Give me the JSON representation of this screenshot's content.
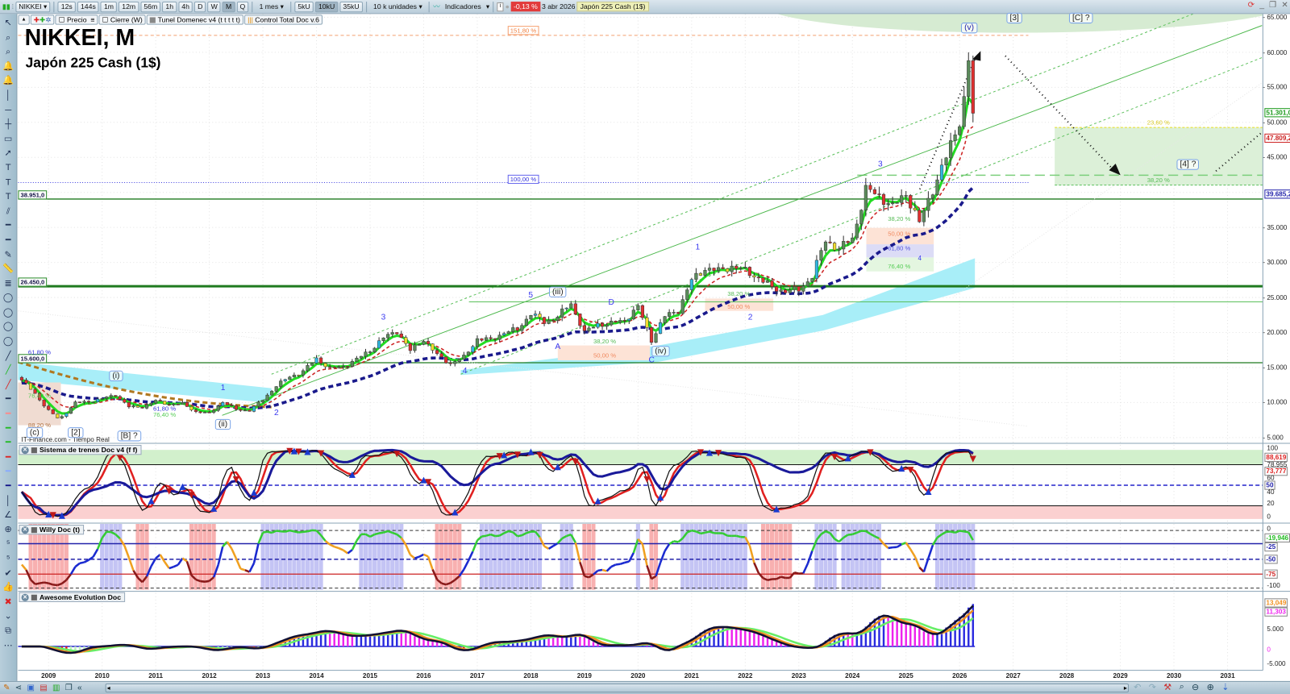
{
  "toolbar": {
    "symbol": "NIKKEI",
    "timeframes": [
      "12s",
      "144s",
      "1m",
      "12m",
      "56m",
      "1h",
      "4h",
      "D",
      "W",
      "M",
      "Q"
    ],
    "active_timeframe": "M",
    "period": "1 mes",
    "units": [
      "5kU",
      "10kU",
      "35kU"
    ],
    "active_unit": "10kU",
    "unit_select": "10 k unidades",
    "indicators": "Indicadores",
    "change": "-0,13 %",
    "date": "3 abr 2026",
    "instrument": "Japón 225 Cash (1$)"
  },
  "legend_row": [
    "Precio",
    "Cierre (W)",
    "Tunel Domenec v4 (t t t t t)",
    "Control Total Doc v.6"
  ],
  "chart": {
    "title": "NIKKEI, M",
    "subtitle": "Japón 225 Cash (1$)",
    "watermark": "IT-Finance.com - Tiempo Real"
  },
  "left_tools": [
    "cursor-icon",
    "zoom-icon",
    "zoom-area-icon",
    "alert-edit-icon",
    "alert-icon",
    "vertical-line-icon",
    "horizontal-line-icon",
    "cross-line-icon",
    "rectangle-icon",
    "arrow-icon",
    "text-icon",
    "text-box-icon",
    "text-marker-icon",
    "channel-icon",
    "line-tool-icon",
    "line-tool-icon-2",
    "pen-icon",
    "ruler-icon",
    "fibonacci-icon",
    "ellipse-icon",
    "ellipse-icon-2",
    "ellipse-icon-3",
    "ellipse-icon-4",
    "trendline-black-icon",
    "trendline-green-icon",
    "trendline-red-icon",
    "line-gray-icon",
    "line-salmon-icon",
    "line-green-icon",
    "line-darkgreen-icon",
    "line-red-icon",
    "line-lightblue-icon",
    "line-navy-icon",
    "vertical-bar-icon",
    "angle-icon",
    "target-icon",
    "elliott-icon",
    "elliott-abc-icon",
    "checkmark-icon",
    "thumbs-up-icon",
    "delete-icon",
    "collapse-icon",
    "layers-icon",
    "more-icon"
  ],
  "price_levels": [
    "38.951,0",
    "26.450,0",
    "15.600,0"
  ],
  "wave_labels": [
    "1",
    "2",
    "3",
    "4",
    "5",
    "1",
    "2",
    "3",
    "4",
    "A",
    "D",
    "C"
  ],
  "boxed_labels": [
    "(i)",
    "(ii)",
    "(iii)",
    "(iv)",
    "(v)",
    "[3]",
    "[C] ?",
    "[4] ?",
    "(c)",
    "[2]",
    "[B] ?"
  ],
  "fib_labels": [
    "151,80 %",
    "100,00 %",
    "61,80 %",
    "76,40 %",
    "88,20 %",
    "61,80 %",
    "76,40 %",
    "38,20 %",
    "50,00 %",
    "38,20 %",
    "50,00 %",
    "38,20 %",
    "50,00 %",
    "61,80 %",
    "76,40 %",
    "23,60 %",
    "38,20 %"
  ],
  "panels": {
    "trenes": "Sistema de trenes Doc v4 (f f)",
    "willy": "Willy Doc (t)",
    "awesome": "Awesome Evolution Doc"
  },
  "axis": {
    "price_ticks": [
      "65.000",
      "60.000",
      "55.000",
      "50.000",
      "45.000",
      "35.000",
      "30.000",
      "25.000",
      "20.000",
      "15.000",
      "10.000",
      "5.000"
    ],
    "price_badges": {
      "close": "51.301,0",
      "ema": "47.809,2",
      "trend": "39.685,2"
    },
    "trenes_ticks": [
      "100",
      "78,955",
      "60",
      "40",
      "20",
      "0"
    ],
    "trenes_badges": {
      "a": "88,619",
      "b": "73,777",
      "mid": "50"
    },
    "willy_ticks": [
      "0",
      "-100"
    ],
    "willy_badges": {
      "value": "-19,946",
      "l25": "-25",
      "l50": "-50",
      "l75": "-75"
    },
    "awesome_ticks": [
      "5.000",
      "0",
      "-5.000"
    ],
    "awesome_badges": {
      "a": "13,049",
      "b": "11,303"
    },
    "years": [
      "2009",
      "2010",
      "2011",
      "2012",
      "2013",
      "2014",
      "2015",
      "2016",
      "2017",
      "2018",
      "2019",
      "2020",
      "2021",
      "2022",
      "2023",
      "2024",
      "2025",
      "2026",
      "2027",
      "2028",
      "2029",
      "2030",
      "2031"
    ]
  },
  "colors": {
    "up": "#5b8c5b",
    "down": "#e03030",
    "alt_up": "#30b8e0",
    "alt_down": "#f0dc30",
    "ema_fast": "#22dd22",
    "ema_mid": "#cc2222",
    "ema_slow": "#1a1a8c",
    "level": "#1f7a1f"
  },
  "chart_data": {
    "type": "candlestick",
    "timeframe": "monthly",
    "price_points": [
      [
        2008.5,
        13200
      ],
      [
        2008.75,
        11260
      ],
      [
        2009.0,
        8860
      ],
      [
        2009.2,
        7570
      ],
      [
        2009.5,
        9960
      ],
      [
        2009.75,
        10130
      ],
      [
        2010.0,
        10550
      ],
      [
        2010.25,
        11090
      ],
      [
        2010.5,
        9380
      ],
      [
        2010.75,
        9370
      ],
      [
        2011.0,
        10230
      ],
      [
        2011.25,
        9760
      ],
      [
        2011.5,
        9820
      ],
      [
        2011.75,
        8700
      ],
      [
        2012.0,
        8460
      ],
      [
        2012.25,
        10080
      ],
      [
        2012.5,
        9010
      ],
      [
        2012.75,
        8870
      ],
      [
        2013.0,
        10400
      ],
      [
        2013.25,
        12400
      ],
      [
        2013.5,
        13680
      ],
      [
        2013.75,
        14460
      ],
      [
        2014.0,
        16290
      ],
      [
        2014.25,
        14830
      ],
      [
        2014.5,
        15160
      ],
      [
        2014.75,
        16170
      ],
      [
        2015.0,
        17450
      ],
      [
        2015.25,
        19210
      ],
      [
        2015.5,
        20240
      ],
      [
        2015.75,
        17390
      ],
      [
        2016.0,
        19030
      ],
      [
        2016.25,
        16760
      ],
      [
        2016.5,
        15580
      ],
      [
        2016.75,
        16450
      ],
      [
        2017.0,
        19110
      ],
      [
        2017.25,
        18910
      ],
      [
        2017.5,
        20030
      ],
      [
        2017.75,
        20360
      ],
      [
        2018.0,
        22760
      ],
      [
        2018.25,
        21450
      ],
      [
        2018.5,
        22300
      ],
      [
        2018.75,
        24120
      ],
      [
        2019.0,
        20010
      ],
      [
        2019.25,
        21200
      ],
      [
        2019.5,
        21280
      ],
      [
        2019.75,
        21760
      ],
      [
        2020.0,
        23660
      ],
      [
        2020.25,
        18920
      ],
      [
        2020.5,
        22290
      ],
      [
        2020.75,
        23190
      ],
      [
        2021.0,
        27440
      ],
      [
        2021.25,
        29180
      ],
      [
        2021.5,
        28790
      ],
      [
        2021.75,
        29450
      ],
      [
        2022.0,
        28790
      ],
      [
        2022.25,
        27820
      ],
      [
        2022.5,
        26390
      ],
      [
        2022.75,
        25940
      ],
      [
        2023.0,
        26090
      ],
      [
        2023.25,
        28040
      ],
      [
        2023.5,
        33190
      ],
      [
        2023.75,
        31860
      ],
      [
        2024.0,
        33460
      ],
      [
        2024.25,
        40370
      ],
      [
        2024.5,
        39580
      ],
      [
        2024.75,
        37920
      ],
      [
        2025.0,
        39890
      ],
      [
        2025.25,
        35620
      ],
      [
        2025.5,
        40490
      ],
      [
        2025.75,
        44930
      ],
      [
        2026.0,
        50340
      ],
      [
        2026.083,
        53300
      ],
      [
        2026.167,
        58800
      ],
      [
        2026.25,
        51301
      ]
    ],
    "ylim": [
      5000,
      65000
    ],
    "xlim": [
      2008.43,
      2031.7
    ],
    "horizontal_levels": [
      38951,
      26450,
      15600
    ],
    "last_close": 51301
  }
}
